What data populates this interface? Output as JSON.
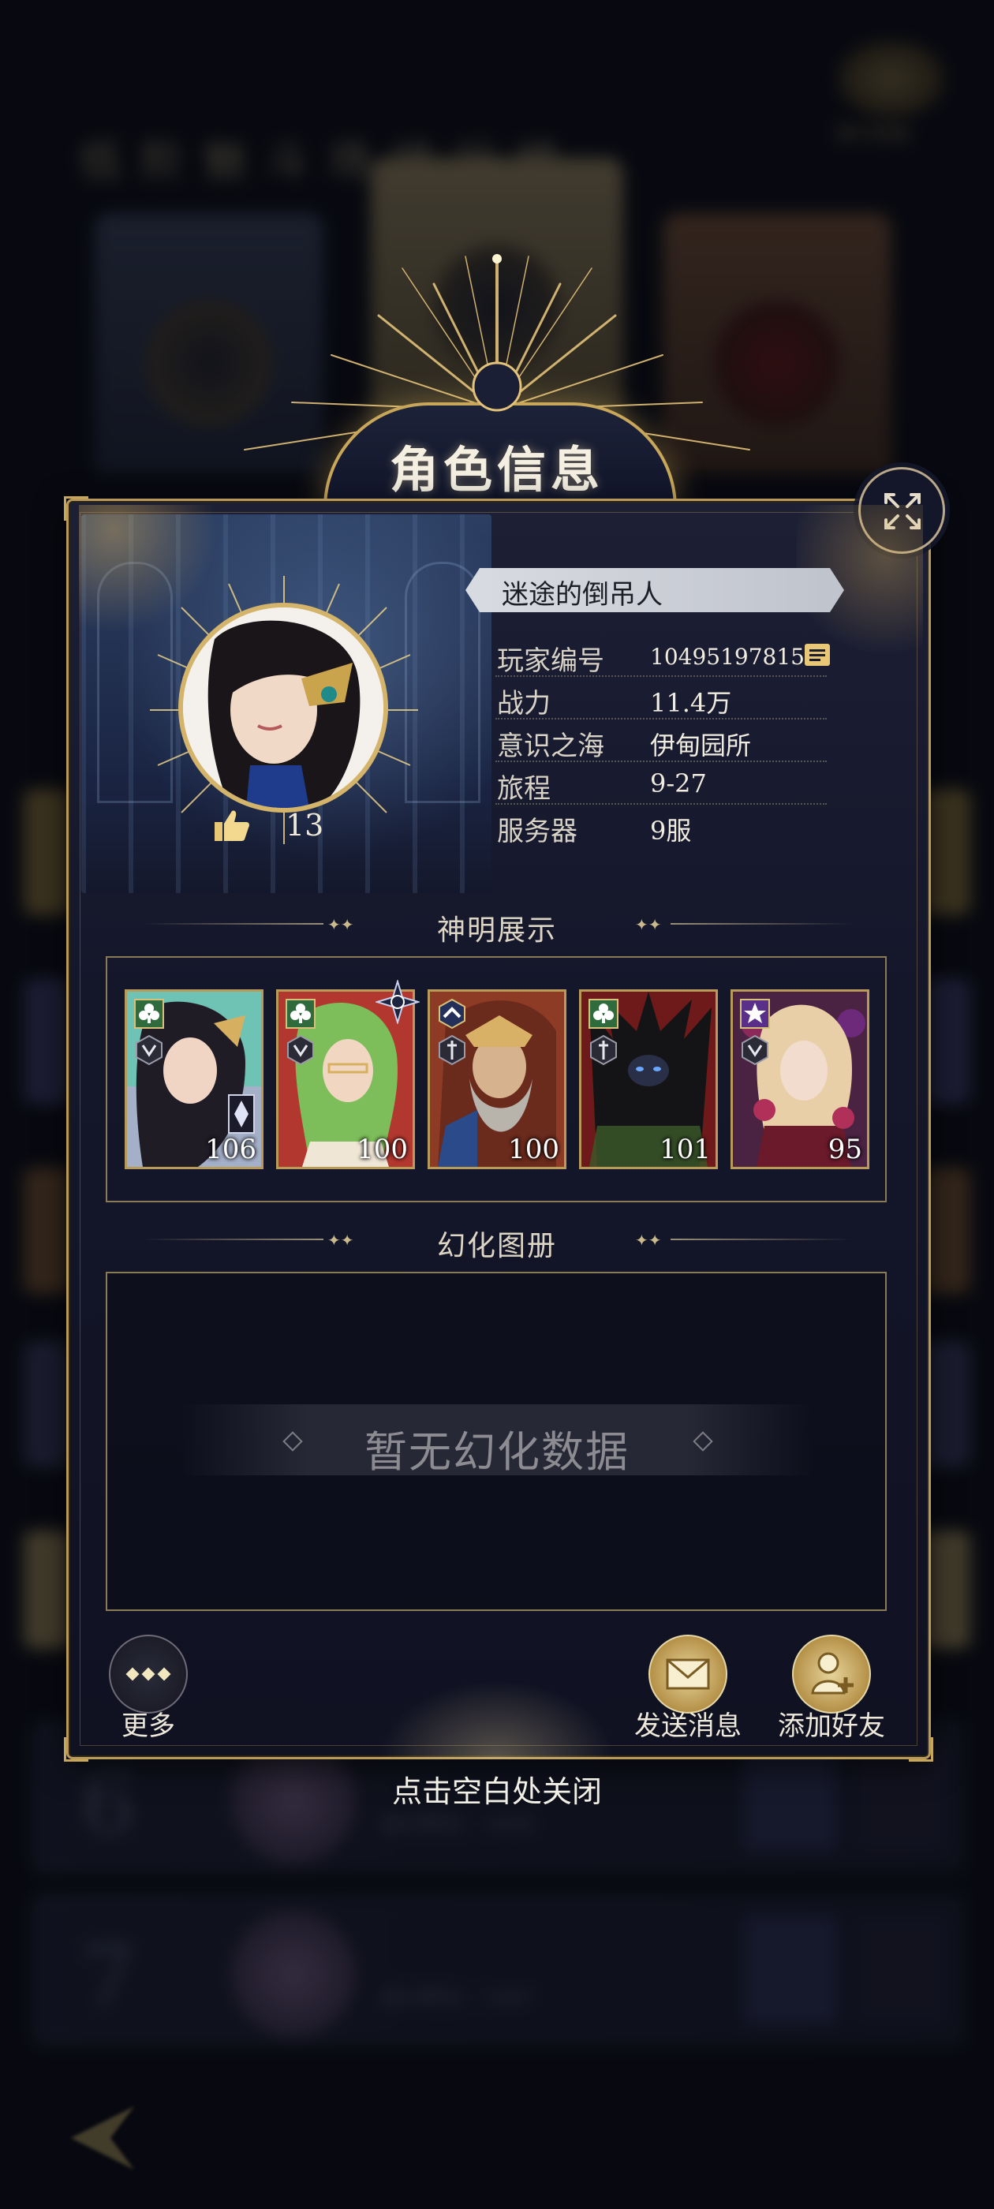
{
  "background": {
    "leaderboard_title": "低 阶 魅 斗 场 排 行 榜",
    "crown_label": "排行奖励",
    "rows": [
      {
        "rank": "6",
        "sub": "战斗积分：1450"
      },
      {
        "rank": "7",
        "sub": "战斗积分：1447"
      }
    ]
  },
  "header": {
    "title": "角色信息"
  },
  "profile": {
    "name": "迷途的倒吊人",
    "likes": "13",
    "fields": [
      {
        "label": "玩家编号",
        "value": "10495197815"
      },
      {
        "label": "战力",
        "value": "11.4万"
      },
      {
        "label": "意识之海",
        "value": "伊甸园所"
      },
      {
        "label": "旅程",
        "value": "9-27"
      },
      {
        "label": "服务器",
        "value": "9服"
      }
    ]
  },
  "sections": {
    "showcase_title": "神明展示",
    "gallery_title": "幻化图册",
    "gallery_empty": "暂无幻化数据"
  },
  "cards": [
    {
      "level": "106",
      "bg": "#5fb0a4",
      "accent": "#1f1e28"
    },
    {
      "level": "100",
      "bg": "#b2372f",
      "accent": "#7dbd5a"
    },
    {
      "level": "100",
      "bg": "#9a4a2a",
      "accent": "#d8b066"
    },
    {
      "level": "101",
      "bg": "#7a1e1e",
      "accent": "#161618"
    },
    {
      "level": "95",
      "bg": "#5e2e4e",
      "accent": "#e8c8b0"
    }
  ],
  "buttons": {
    "more": "更多",
    "send_message": "发送消息",
    "add_friend": "添加好友"
  },
  "close_hint": "点击空白处关闭",
  "colors": {
    "gold": "#c9a75a",
    "panel": "#14162a"
  }
}
